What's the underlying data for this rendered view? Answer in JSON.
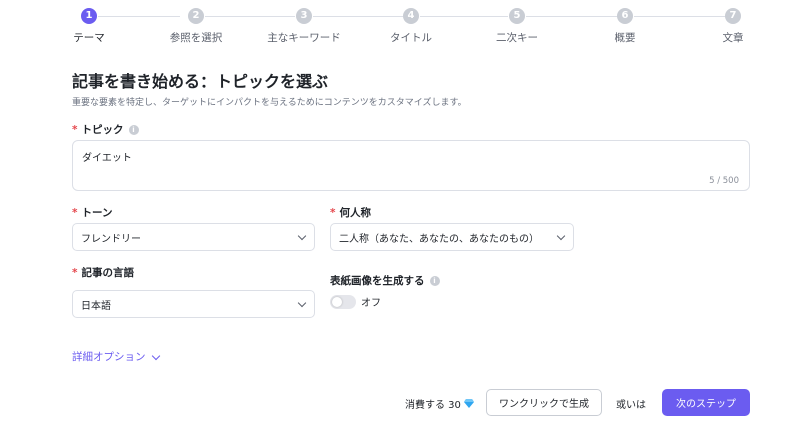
{
  "stepper": {
    "steps": [
      {
        "number": "1",
        "label": "テーマ"
      },
      {
        "number": "2",
        "label": "参照を選択"
      },
      {
        "number": "3",
        "label": "主なキーワード"
      },
      {
        "number": "4",
        "label": "タイトル"
      },
      {
        "number": "5",
        "label": "二次キー"
      },
      {
        "number": "6",
        "label": "概要"
      },
      {
        "number": "7",
        "label": "文章"
      }
    ],
    "active_step": 1
  },
  "header": {
    "title": "記事を書き始める：トピックを選ぶ",
    "description": "重要な要素を特定し、ターゲットにインパクトを与えるためにコンテンツをカスタマイズします。"
  },
  "form": {
    "required_mark": "*",
    "topic": {
      "label": "トピック",
      "value": "ダイエット",
      "counter": "5 / 500"
    },
    "tone": {
      "label": "トーン",
      "value": "フレンドリー"
    },
    "person": {
      "label": "何人称",
      "value": "二人称（あなた、あなたの、あなたのもの）"
    },
    "language": {
      "label": "記事の言語",
      "value": "日本語"
    },
    "cover_image": {
      "label": "表紙画像を生成する",
      "toggle_state": "オフ"
    },
    "advanced_options": "詳細オプション"
  },
  "footer": {
    "cost_text": "消費する 30",
    "one_click_button": "ワンクリックで生成",
    "or_text": "或いは",
    "next_button": "次のステップ"
  },
  "colors": {
    "accent": "#6b5cf0",
    "required": "#e5484d",
    "gem": "#2fa6f0"
  }
}
